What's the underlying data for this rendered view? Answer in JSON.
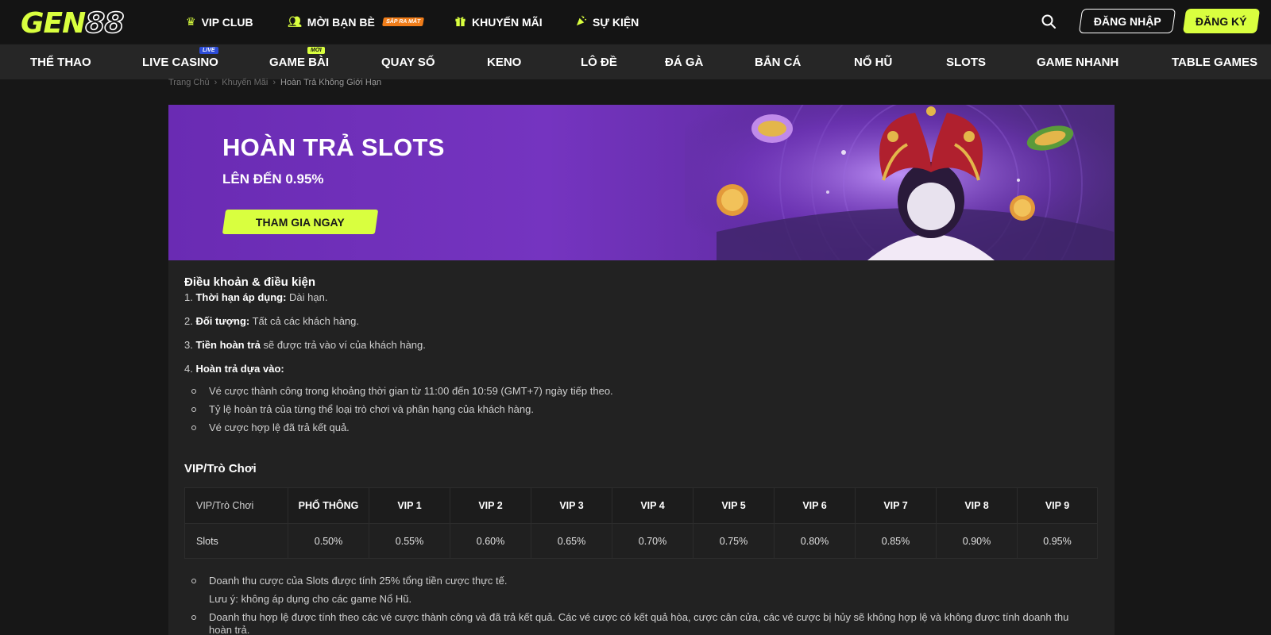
{
  "header": {
    "logo_main": "GEN",
    "logo_num": "88",
    "nav": [
      {
        "label": "VIP CLUB",
        "icon": "crown-icon"
      },
      {
        "label": "MỜI BẠN BÈ",
        "icon": "users-icon",
        "badge": "SẮP RA MẮT"
      },
      {
        "label": "KHUYẾN MÃI",
        "icon": "gift-icon"
      },
      {
        "label": "SỰ KIỆN",
        "icon": "party-icon"
      }
    ],
    "login_label": "ĐĂNG NHẬP",
    "register_label": "ĐĂNG KÝ"
  },
  "categories": [
    {
      "label": "THỂ THAO"
    },
    {
      "label": "LIVE CASINO",
      "badge": "LIVE"
    },
    {
      "label": "GAME BÀI",
      "badge": "MỚI"
    },
    {
      "label": "QUAY SỐ"
    },
    {
      "label": "KENO"
    },
    {
      "label": "LÔ ĐỀ"
    },
    {
      "label": "ĐÁ GÀ"
    },
    {
      "label": "BẮN CÁ"
    },
    {
      "label": "NỔ HŨ"
    },
    {
      "label": "SLOTS"
    },
    {
      "label": "GAME NHANH"
    },
    {
      "label": "TABLE GAMES"
    }
  ],
  "breadcrumb": [
    "Trang Chủ",
    "Khuyến Mãi",
    "Hoàn Trả Không Giới Hạn"
  ],
  "banner": {
    "title": "HOÀN TRẢ SLOTS",
    "subtitle": "LÊN ĐẾN 0.95%",
    "cta": "THAM GIA NGAY"
  },
  "terms": {
    "heading": "Điều khoản & điều kiện",
    "items": [
      {
        "num": "1.",
        "bold": "Thời hạn áp dụng:",
        "text": " Dài hạn."
      },
      {
        "num": "2.",
        "bold": "Đối tượng:",
        "text": " Tất cả các khách hàng."
      },
      {
        "num": "3.",
        "bold": "Tiền hoàn trả",
        "text": " sẽ được trả vào ví của khách hàng."
      },
      {
        "num": "4.",
        "bold": "Hoàn trả dựa vào:",
        "text": ""
      }
    ],
    "bullets": [
      "Vé cược thành công trong khoảng thời gian từ 11:00 đến 10:59 (GMT+7) ngày tiếp theo.",
      "Tỷ lệ hoàn trả của từng thể loại trò chơi và phân hạng của khách hàng.",
      "Vé cược hợp lệ đã trả kết quả."
    ]
  },
  "vip_table": {
    "heading": "VIP/Trò Chơi",
    "columns": [
      "VIP/Trò Chơi",
      "PHỔ THÔNG",
      "VIP 1",
      "VIP 2",
      "VIP 3",
      "VIP 4",
      "VIP 5",
      "VIP 6",
      "VIP 7",
      "VIP 8",
      "VIP 9"
    ],
    "rows": [
      [
        "Slots",
        "0.50%",
        "0.55%",
        "0.60%",
        "0.65%",
        "0.70%",
        "0.75%",
        "0.80%",
        "0.85%",
        "0.90%",
        "0.95%"
      ]
    ]
  },
  "notes": [
    "Doanh thu cược của Slots được tính 25% tổng tiền cược thực tế.",
    "Lưu ý: không áp dụng cho các game Nổ Hũ.",
    "Doanh thu hợp lệ được tính theo các vé cược thành công và đã trả kết quả. Các vé cược có kết quả hòa, cược cân cửa, các vé cược bị hủy sẽ không hợp lệ và không được tính doanh thu",
    "hoàn trả."
  ],
  "colors": {
    "accent": "#d9ff3f",
    "background": "#171717",
    "banner_purple": "#7534c0"
  }
}
